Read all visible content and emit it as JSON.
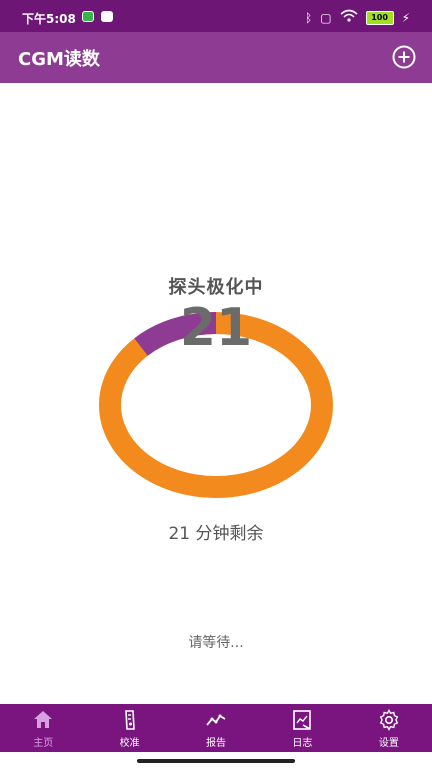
{
  "status_bar": {
    "time": "下午5:08",
    "battery": "100"
  },
  "app_bar": {
    "title": "CGM读数"
  },
  "main": {
    "status_title": "探头极化中",
    "countdown": "21",
    "remaining_text": "21 分钟剩余",
    "waiting_text": "请等待...",
    "ring": {
      "progress_fraction": 0.125,
      "colors": {
        "remaining": "#f28a1d",
        "elapsed": "#8e3c93"
      }
    }
  },
  "bottom_nav": {
    "items": [
      {
        "label": "主页",
        "icon": "home-icon",
        "active": true
      },
      {
        "label": "校准",
        "icon": "calibration-icon",
        "active": false
      },
      {
        "label": "报告",
        "icon": "report-icon",
        "active": false
      },
      {
        "label": "日志",
        "icon": "log-icon",
        "active": false
      },
      {
        "label": "设置",
        "icon": "settings-icon",
        "active": false
      }
    ]
  },
  "colors": {
    "status_bar": "#6d1675",
    "app_bar": "#8e3c93",
    "bottom_nav": "#7a157f",
    "accent_orange": "#f28a1d"
  }
}
